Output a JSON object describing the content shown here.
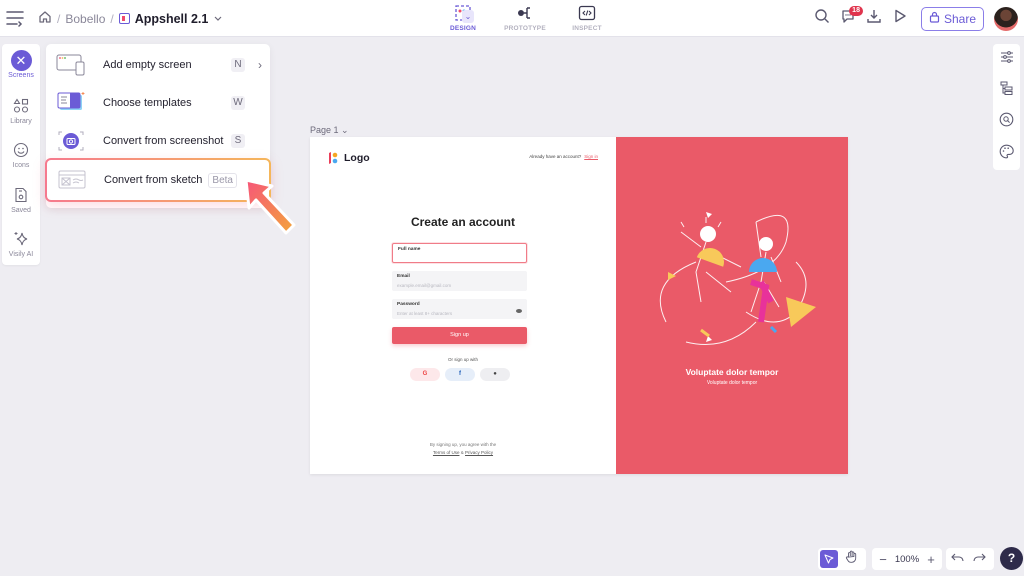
{
  "header": {
    "breadcrumb": {
      "home_icon": "home-icon",
      "workspace": "Bobello",
      "project": "Appshell 2.1",
      "separator": "/"
    },
    "modes": [
      {
        "label": "DESIGN",
        "icon": "design-icon",
        "active": true
      },
      {
        "label": "PROTOTYPE",
        "icon": "prototype-icon",
        "active": false
      },
      {
        "label": "INSPECT",
        "icon": "code-icon",
        "active": false
      }
    ],
    "comments_badge": "18",
    "share_label": "Share"
  },
  "left_rail": {
    "items": [
      {
        "label": "Screens",
        "icon": "close-icon",
        "active": true
      },
      {
        "label": "Library",
        "icon": "library-icon"
      },
      {
        "label": "Icons",
        "icon": "smiley-icon"
      },
      {
        "label": "Saved",
        "icon": "saved-icon"
      },
      {
        "label": "Visily AI",
        "icon": "sparkle-icon"
      }
    ]
  },
  "screens_menu": {
    "items": [
      {
        "label": "Add empty screen",
        "shortcut": "N",
        "has_submenu": true
      },
      {
        "label": "Choose templates",
        "shortcut": "W"
      },
      {
        "label": "Convert from screenshot",
        "shortcut": "S"
      },
      {
        "label": "Convert from sketch",
        "badge": "Beta",
        "highlighted": true
      }
    ]
  },
  "canvas": {
    "page_label": "Page 1",
    "screen": {
      "logo_text": "Logo",
      "already_text": "Already have an account?",
      "sign_in": "Sign in",
      "title": "Create an account",
      "fields": [
        {
          "label": "Full name",
          "placeholder": ""
        },
        {
          "label": "Email",
          "placeholder": "example.email@gmail.com"
        },
        {
          "label": "Password",
          "placeholder": "Enter at least 8+ characters"
        }
      ],
      "signup_button": "Sign up",
      "or_text": "Or sign up with",
      "social": [
        "G",
        "f",
        ""
      ],
      "terms_line1": "By signing up, you agree with the",
      "terms_link": "Terms of Use",
      "terms_amp": "&",
      "privacy_link": "Privacy Policy",
      "hero_title": "Voluptate dolor tempor",
      "hero_subtitle": "Voluptate dolor tempor"
    }
  },
  "bottom_toolbar": {
    "zoom": "100%",
    "help": "?"
  },
  "colors": {
    "accent": "#6b5bd6",
    "brand_red": "#ea5a68",
    "badge": "#e0344d"
  }
}
